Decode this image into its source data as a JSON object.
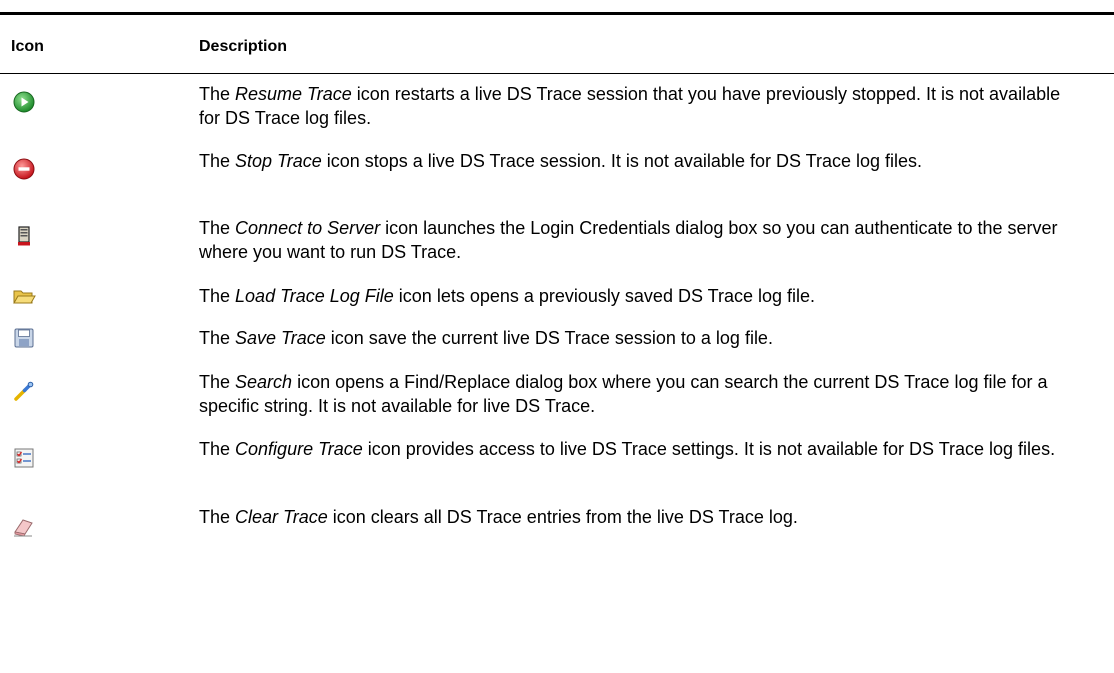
{
  "table": {
    "headers": {
      "icon": "Icon",
      "description": "Description"
    },
    "rows": [
      {
        "icon": "resume-trace-icon",
        "prefix": "The ",
        "name": "Resume Trace",
        "rest": " icon restarts a live DS Trace session that you have previously stopped. It is not available for DS Trace log files."
      },
      {
        "icon": "stop-trace-icon",
        "prefix": "The ",
        "name": "Stop Trace",
        "rest": " icon stops a live DS Trace session. It is not available for DS Trace log files."
      },
      {
        "icon": "connect-to-server-icon",
        "prefix": "The ",
        "name": "Connect to Server",
        "rest": " icon launches the Login Credentials dialog box so you can authenticate to the server where you want to run DS Trace."
      },
      {
        "icon": "load-trace-log-file-icon",
        "prefix": "The ",
        "name": "Load Trace Log File",
        "rest": " icon lets opens a previously saved DS Trace log file."
      },
      {
        "icon": "save-trace-icon",
        "prefix": "The ",
        "name": "Save Trace",
        "rest": " icon save the current live DS Trace session to a log file."
      },
      {
        "icon": "search-icon",
        "prefix": "The ",
        "name": "Search",
        "rest": " icon opens a Find/Replace dialog box where you can search the current DS Trace log file for a specific string. It is not available for live DS Trace."
      },
      {
        "icon": "configure-trace-icon",
        "prefix": "The ",
        "name": "Configure Trace",
        "rest": " icon provides access to live DS Trace settings. It is not available for DS Trace log files."
      },
      {
        "icon": "clear-trace-icon",
        "prefix": "The ",
        "name": "Clear Trace",
        "rest": " icon clears all DS Trace entries from the live DS Trace log."
      }
    ]
  }
}
